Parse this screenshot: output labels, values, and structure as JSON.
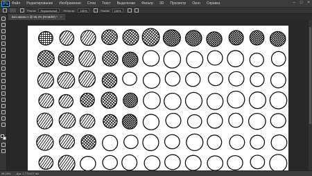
{
  "app": {
    "logo": "Ps"
  },
  "menu": [
    "Файл",
    "Редактирование",
    "Изображение",
    "Слои",
    "Текст",
    "Выделение",
    "Фильтр",
    "3D",
    "Просмотр",
    "Окно",
    "Справка"
  ],
  "window_controls": {
    "minimize": "–",
    "maximize": "□",
    "close": "×"
  },
  "options": {
    "mode_label": "Режим:",
    "mode_value": "Нормальный",
    "opacity_label": "Непрозр.:",
    "opacity_value": "100%",
    "flow_label": "Нажим:",
    "flow_value": "100%"
  },
  "document_tab": {
    "title": "Без имени-1 @ 85,2% (RGB/8#) *",
    "close": "×"
  },
  "status": {
    "zoom": "85,29%",
    "doc_info": "Док: 2,77M/27,3M"
  },
  "colors": {
    "foreground": "#000000",
    "background": "#ffffff",
    "chrome": "#353535",
    "canvas": "#ffffff"
  },
  "tool_icons": [
    "move-icon",
    "marquee-icon",
    "lasso-icon",
    "quick-select-icon",
    "crop-icon",
    "eyedropper-icon",
    "healing-icon",
    "brush-icon",
    "stamp-icon",
    "history-brush-icon",
    "eraser-icon",
    "gradient-icon",
    "blur-icon",
    "dodge-icon",
    "pen-icon",
    "type-icon",
    "path-select-icon",
    "shape-icon",
    "hand-icon",
    "zoom-icon"
  ],
  "canvas_content": {
    "description_rows": 7,
    "columns": 12
  }
}
